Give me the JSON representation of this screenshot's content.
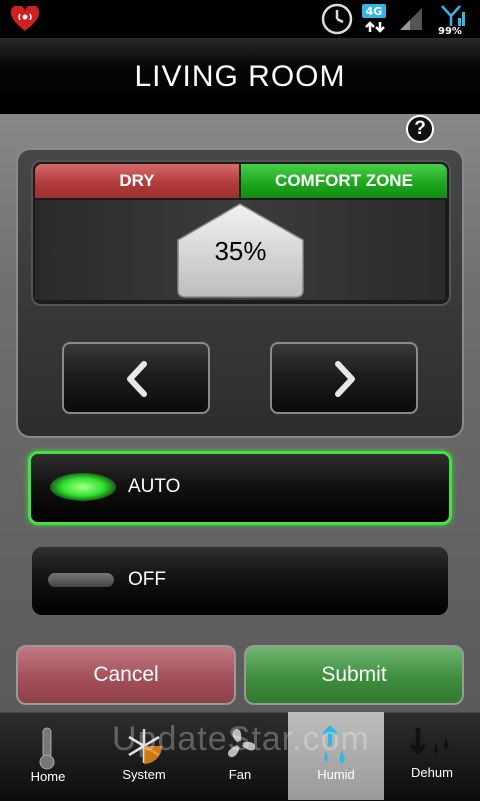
{
  "status_bar": {
    "network": "4G",
    "battery": "99%",
    "icons": [
      "iheart-icon",
      "clock-icon",
      "4g-icon",
      "signal-icon",
      "wifi-signal-icon"
    ]
  },
  "header": {
    "title": "LIVING ROOM"
  },
  "help": {
    "label": "?"
  },
  "gauge": {
    "left_segment": "DRY",
    "right_segment": "COMFORT ZONE",
    "value": "35%",
    "value_fraction": 0.35,
    "colors": {
      "dry": "#b33b3b",
      "comfort": "#1fa81f"
    }
  },
  "modes": {
    "auto": {
      "label": "AUTO",
      "active": true
    },
    "off": {
      "label": "OFF",
      "active": false
    }
  },
  "actions": {
    "cancel": "Cancel",
    "submit": "Submit"
  },
  "nav": [
    {
      "label": "Home",
      "icon": "thermometer-icon",
      "active": false
    },
    {
      "label": "System",
      "icon": "snowflake-sun-icon",
      "active": false
    },
    {
      "label": "Fan",
      "icon": "fan-icon",
      "active": false
    },
    {
      "label": "Humid",
      "icon": "humid-icon",
      "active": true
    },
    {
      "label": "Dehum",
      "icon": "dehum-icon",
      "active": false
    }
  ],
  "watermark": "UpdateStar.com",
  "accent_colors": {
    "auto_glow": "#46e046",
    "cancel": "#a5505a",
    "submit": "#3f8f3f"
  }
}
